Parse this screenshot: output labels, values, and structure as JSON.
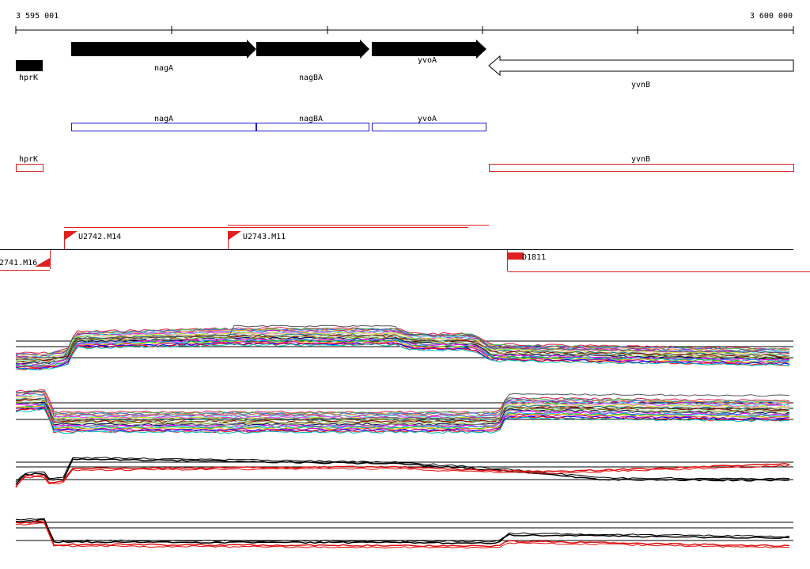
{
  "ruler": {
    "start": "3 595 001",
    "end": "3 600 000"
  },
  "genes": [
    {
      "name": "hprK",
      "strand": "+",
      "style": "solid"
    },
    {
      "name": "nagA",
      "strand": "+",
      "style": "solid"
    },
    {
      "name": "nagBA",
      "strand": "+",
      "style": "solid"
    },
    {
      "name": "yvoA",
      "strand": "+",
      "style": "solid"
    },
    {
      "name": "yvnB",
      "strand": "-",
      "style": "outline"
    }
  ],
  "operons": {
    "blue": [
      "nagA",
      "nagBA",
      "yvoA"
    ],
    "red": [
      "hprK",
      "yvnB"
    ]
  },
  "segments": [
    "U2742.M14",
    "U2743.M11",
    "2741.M16",
    "D1811"
  ],
  "colors": {
    "gene_fill": "#000000",
    "blue_operon": "#1c1cc8",
    "red_operon": "#d21e1e",
    "segment": "#e02020",
    "profile_a": "#000000",
    "profile_b": "#e01010"
  }
}
